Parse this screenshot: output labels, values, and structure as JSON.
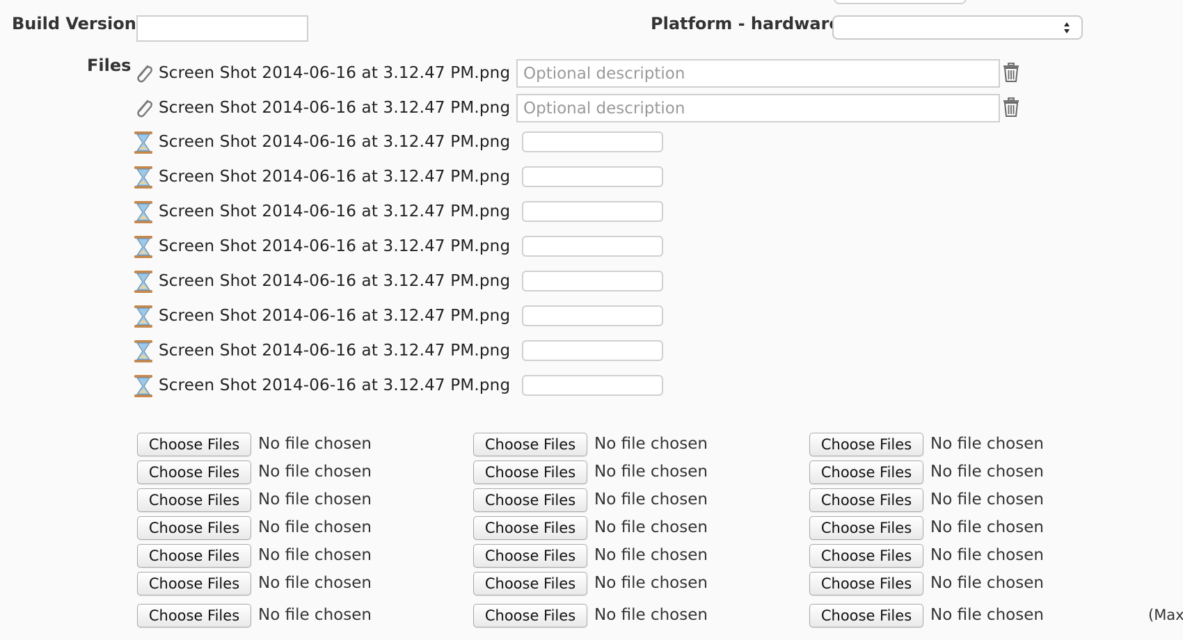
{
  "build_version": {
    "label": "Build Version",
    "value": ""
  },
  "platform": {
    "label": "Platform - hardware",
    "selected": ""
  },
  "files": {
    "label": "Files",
    "attached": [
      {
        "name": "Screen Shot 2014-06-16 at 3.12.47 PM.png",
        "status": "attached",
        "description_placeholder": "Optional description"
      },
      {
        "name": "Screen Shot 2014-06-16 at 3.12.47 PM.png",
        "status": "attached",
        "description_placeholder": "Optional description"
      }
    ],
    "pending": [
      {
        "name": "Screen Shot 2014-06-16 at 3.12.47 PM.png",
        "status": "uploading"
      },
      {
        "name": "Screen Shot 2014-06-16 at 3.12.47 PM.png",
        "status": "uploading"
      },
      {
        "name": "Screen Shot 2014-06-16 at 3.12.47 PM.png",
        "status": "uploading"
      },
      {
        "name": "Screen Shot 2014-06-16 at 3.12.47 PM.png",
        "status": "uploading"
      },
      {
        "name": "Screen Shot 2014-06-16 at 3.12.47 PM.png",
        "status": "uploading"
      },
      {
        "name": "Screen Shot 2014-06-16 at 3.12.47 PM.png",
        "status": "uploading"
      },
      {
        "name": "Screen Shot 2014-06-16 at 3.12.47 PM.png",
        "status": "uploading"
      },
      {
        "name": "Screen Shot 2014-06-16 at 3.12.47 PM.png",
        "status": "uploading"
      }
    ]
  },
  "file_pickers": {
    "button_label": "Choose Files",
    "status_text": "No file chosen",
    "rows": 7,
    "columns": 3
  },
  "max_note": "(Maxi",
  "icons": {
    "attached": "paperclip-icon",
    "uploading": "hourglass-icon",
    "delete": "trash-icon",
    "select_arrows": "updown-arrows-icon"
  },
  "colors": {
    "background": "#fafafa",
    "hourglass_frame": "#c8874a",
    "hourglass_glass": "#9ec8e8"
  }
}
